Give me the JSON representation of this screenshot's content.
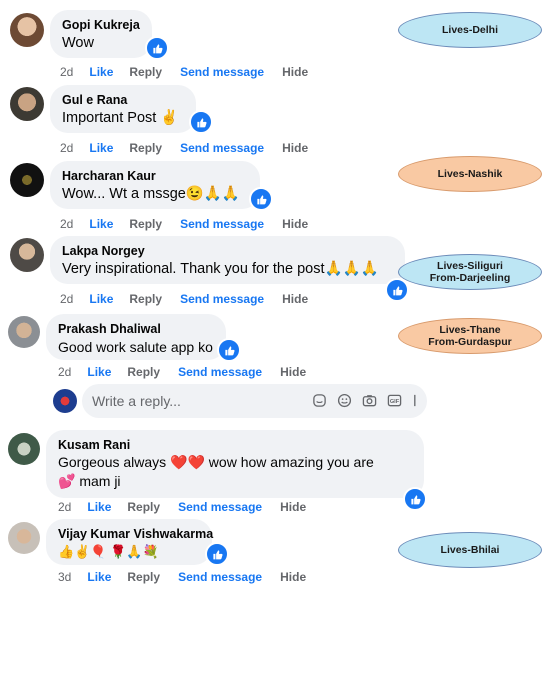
{
  "actions": {
    "like": "Like",
    "reply": "Reply",
    "send": "Send message",
    "hide": "Hide"
  },
  "comments": [
    {
      "name": "Gopi Kukreja",
      "text": "Wow",
      "time": "2d"
    },
    {
      "name": "Gul e Rana",
      "text": "Important Post ✌",
      "time": "2d"
    },
    {
      "name": "Harcharan Kaur",
      "text": "Wow... Wt a mssge😉🙏🙏",
      "time": "2d"
    },
    {
      "name": "Lakpa Norgey",
      "text": "Very inspirational. Thank you for the post🙏🙏🙏",
      "time": "2d"
    },
    {
      "name": "Prakash Dhaliwal",
      "text": "Good work salute app ko",
      "time": "2d"
    },
    {
      "name": "Kusam Rani",
      "text": "Gorgeous always ❤️❤️ wow how amazing you are 💕 mam ji",
      "time": "2d"
    },
    {
      "name": "Vijay Kumar Vishwakarma",
      "text": "👍✌🎈 🌹🙏💐",
      "time": "3d"
    }
  ],
  "reply_box": {
    "placeholder": "Write a reply..."
  },
  "tags": [
    {
      "line1": "Lives-Delhi",
      "line2": ""
    },
    {
      "line1": "Lives-Nashik",
      "line2": ""
    },
    {
      "line1": "Lives-Siliguri",
      "line2": "From-Darjeeling"
    },
    {
      "line1": "Lives-Thane",
      "line2": "From-Gurdaspur"
    },
    {
      "line1": "Lives-Bhilai",
      "line2": ""
    }
  ],
  "colors": {
    "like_blue": "#1877f2",
    "bubble": "#f0f2f5",
    "tag_blue": "#bde6f4",
    "tag_orange": "#f9c9a3"
  }
}
